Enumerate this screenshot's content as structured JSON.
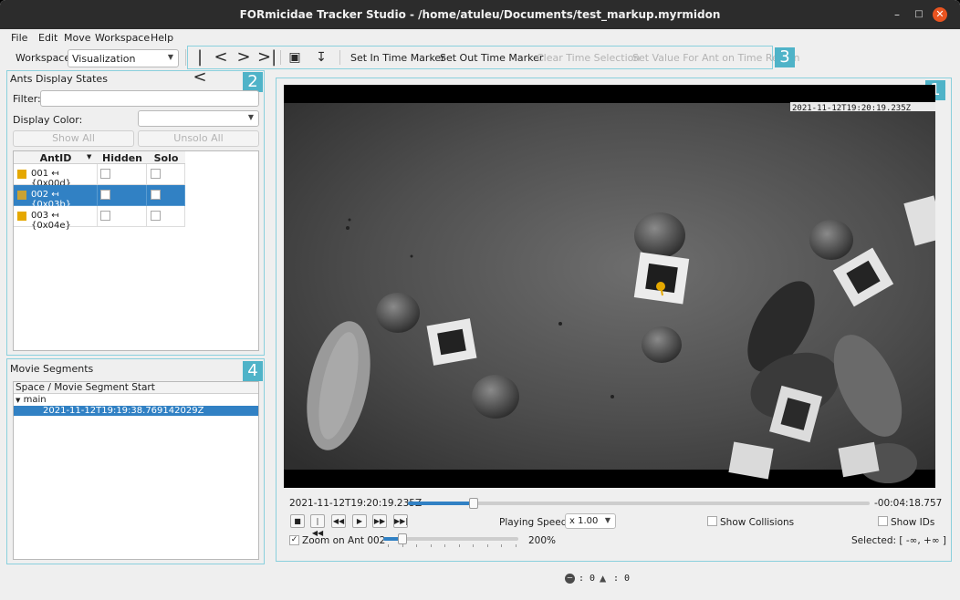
{
  "window": {
    "title": "FORmicidae Tracker Studio - /home/atuleu/Documents/test_markup.myrmidon"
  },
  "menu": [
    "File",
    "Edit",
    "Move",
    "Workspace",
    "Help"
  ],
  "workspace": {
    "label": "Workspace:",
    "value": "Visualization"
  },
  "toolbar": {
    "set_in": "Set In Time Marker",
    "set_out": "Set Out Time Marker",
    "clear_time": "Clear Time Selection",
    "set_value": "Set Value For Ant on Time Region"
  },
  "badges": [
    "1",
    "2",
    "3",
    "4"
  ],
  "ants_panel": {
    "title": "Ants Display States",
    "filter_label": "Filter:",
    "filter_value": "",
    "display_color_label": "Display Color:",
    "show_all": "Show All",
    "unsolo_all": "Unsolo All",
    "columns": [
      "AntID",
      "Hidden",
      "Solo"
    ],
    "rows": [
      {
        "label": "001 ↤ {0x00d}",
        "color": "#e5a800",
        "selected": false
      },
      {
        "label": "002 ↤ {0x03b}",
        "color": "#c9a233",
        "selected": true
      },
      {
        "label": "003 ↤ {0x04e}",
        "color": "#e5a800",
        "selected": false
      }
    ]
  },
  "segments_panel": {
    "title": "Movie Segments",
    "header": "Space / Movie Segment Start",
    "node": "main",
    "child": "2021-11-12T19:19:38.769142029Z"
  },
  "player": {
    "timestamp": "2021-11-12T19:20:19.235Z",
    "remaining": "-00:04:18.757",
    "position_fraction": 0.143,
    "overlay_text": "2021-11-12T19:20:19.235Z",
    "playing_speed_label": "Playing Speed:",
    "playing_speed_value": "x 1.00",
    "show_collisions": "Show Collisions",
    "show_ids": "Show IDs",
    "zoom_label": "Zoom on Ant 002",
    "zoom_checked": true,
    "zoom_value": "200%",
    "zoom_fraction": 0.14,
    "selected": "Selected: [ -∞, +∞ ]"
  },
  "status": {
    "errors": ": 0",
    "warnings": ": 0"
  },
  "colors": {
    "accent": "#3181c4",
    "badge": "#4fb3c8",
    "close": "#e95420"
  }
}
